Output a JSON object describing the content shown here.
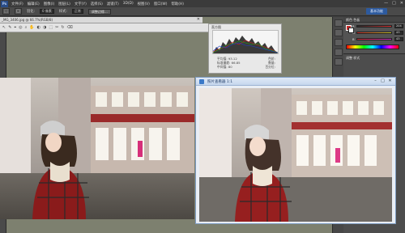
{
  "menubar": {
    "logo": "Ps",
    "items": [
      "文件(F)",
      "编辑(E)",
      "图像(I)",
      "图层(L)",
      "文字(Y)",
      "选择(S)",
      "滤镜(T)",
      "3D(D)",
      "视图(V)",
      "窗口(W)",
      "帮助(H)"
    ],
    "controls": [
      "—",
      "□",
      "✕"
    ]
  },
  "options": {
    "feather_label": "羽化:",
    "feather_value": "0 像素",
    "style_label": "样式:",
    "style_value": "正常",
    "refine_button": "调整边缘...",
    "workspace_button": "基本功能"
  },
  "doc1": {
    "tab_label": "_MG_3406.jpg @ 66.7%(RGB/8)",
    "close": "✕",
    "tool_icons": [
      "↖",
      "✎",
      "⌖",
      "◎",
      "⌕",
      "✋",
      "◐",
      "◑",
      "⬚",
      "✂",
      "↻",
      "⌫"
    ]
  },
  "histogram": {
    "title": "直方图",
    "stats": [
      [
        "平均值: 93.12",
        "色阶: "
      ],
      [
        "标准偏差: 66.85",
        "数量: "
      ],
      [
        "中间值: 80",
        "百分位: "
      ]
    ]
  },
  "color_panel": {
    "tabs": "颜色  色板",
    "channels": [
      {
        "label": "R",
        "value": "204",
        "color": "#c42b2b"
      },
      {
        "label": "G",
        "value": "43",
        "color": "#2bc42b"
      },
      {
        "label": "B",
        "value": "43",
        "color": "#2b2bc4"
      }
    ]
  },
  "adjustments": {
    "label": "调整  样式"
  },
  "doc2": {
    "title": "照片查看器 1:1"
  },
  "colors": {
    "accent": "#2d5a9e",
    "workspace": "#7d806f",
    "panel": "#535353"
  }
}
